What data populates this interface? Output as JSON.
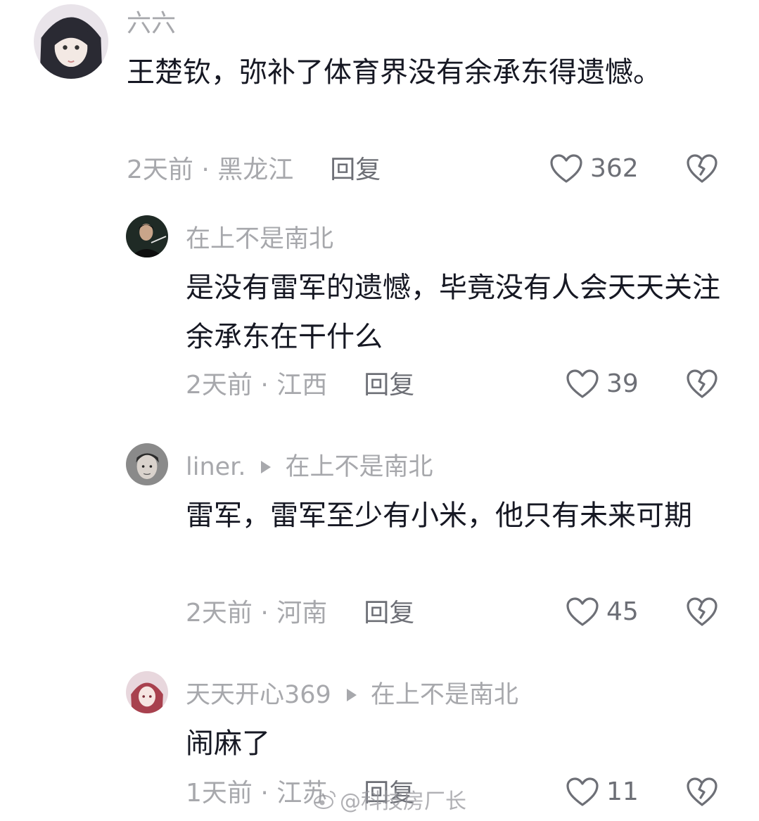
{
  "comments": [
    {
      "author": "六六",
      "text": "王楚钦，弥补了体育界没有余承东得遗憾。",
      "time_location": "2天前 · 黑龙江",
      "reply_label": "回复",
      "likes": "362"
    },
    {
      "author": "在上不是南北",
      "text": "是没有雷军的遗憾，毕竟没有人会天天关注余承东在干什么",
      "time_location": "2天前 · 江西",
      "reply_label": "回复",
      "likes": "39"
    },
    {
      "author": "liner.",
      "reply_to": "在上不是南北",
      "text": "雷军，雷军至少有小米，他只有未来可期",
      "time_location": "2天前 · 河南",
      "reply_label": "回复",
      "likes": "45"
    },
    {
      "author": "天天开心369",
      "reply_to": "在上不是南北",
      "text": "闹麻了",
      "time_location": "1天前 · 江苏",
      "reply_label": "回复",
      "likes": "11"
    }
  ],
  "watermark": "@科技房厂长",
  "icons": {
    "like": "heart-outline-icon",
    "dislike": "broken-heart-icon",
    "reply_arrow": "triangle-right-icon"
  },
  "colors": {
    "text_primary": "#161823",
    "text_secondary": "#a7a8ac",
    "action": "#6d6f76"
  }
}
